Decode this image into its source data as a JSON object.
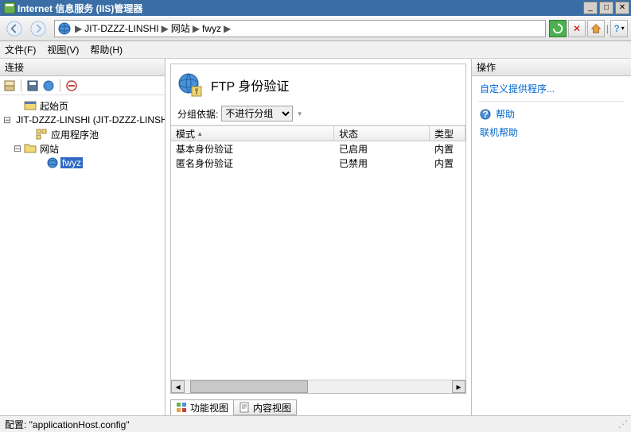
{
  "window": {
    "title": "Internet 信息服务 (IIS)管理器"
  },
  "breadcrumb": {
    "server": "JIT-DZZZ-LINSHI",
    "level1": "网站",
    "level2": "fwyz"
  },
  "menu": {
    "file": "文件(F)",
    "view": "视图(V)",
    "help": "帮助(H)"
  },
  "left": {
    "title": "连接"
  },
  "tree": {
    "start": "起始页",
    "server": "JIT-DZZZ-LINSHI (JIT-DZZZ-LINSHI\\Administrator)",
    "apppools": "应用程序池",
    "sites": "网站",
    "fwyz": "fwyz"
  },
  "page": {
    "title": "FTP 身份验证",
    "groupby_label": "分组依据:",
    "groupby_value": "不进行分组"
  },
  "columns": {
    "mode": "模式",
    "status": "状态",
    "type": "类型"
  },
  "rows": [
    {
      "mode": "基本身份验证",
      "status": "已启用",
      "type": "内置"
    },
    {
      "mode": "匿名身份验证",
      "status": "已禁用",
      "type": "内置"
    }
  ],
  "tabs": {
    "features": "功能视图",
    "content": "内容视图"
  },
  "actions": {
    "title": "操作",
    "custom": "自定义提供程序...",
    "help": "帮助",
    "online": "联机帮助"
  },
  "status": {
    "config": "配置: \"applicationHost.config\""
  }
}
